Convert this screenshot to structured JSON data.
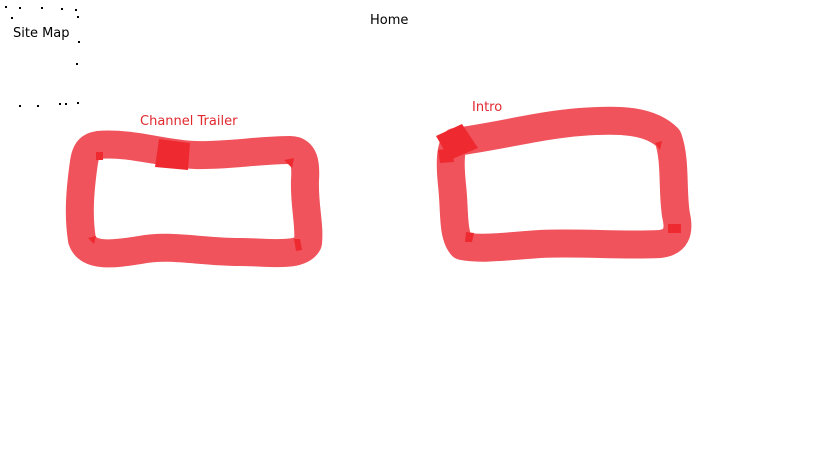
{
  "header": {
    "title": "Home"
  },
  "nav": {
    "site_map_label": "Site Map"
  },
  "sections": [
    {
      "id": "channel-trailer",
      "label": "Channel Trailer"
    },
    {
      "id": "intro",
      "label": "Intro"
    }
  ],
  "colors": {
    "stroke": "#f0535c",
    "accent_patch": "#ee2a30",
    "section_label": "#e0282e",
    "text": "#000000",
    "background": "#ffffff"
  }
}
